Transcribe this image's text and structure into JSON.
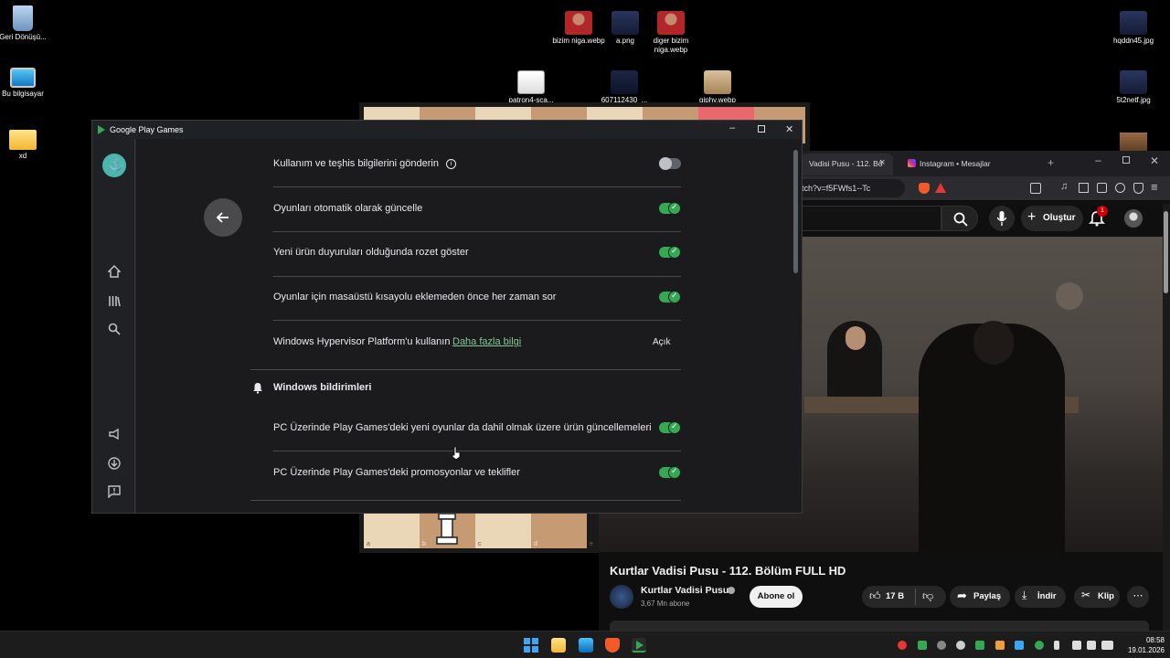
{
  "desktop": {
    "icons": [
      {
        "label": "Geri Dönüşü...",
        "name": "recycle-bin-icon"
      },
      {
        "label": "Bu bilgisayar",
        "name": "this-pc-icon"
      },
      {
        "label": "xd",
        "name": "folder-icon"
      },
      {
        "label": "bizim niga.webp",
        "name": "image-file-icon"
      },
      {
        "label": "a.png",
        "name": "image-file-icon"
      },
      {
        "label": "diger bizim niga.webp",
        "name": "image-file-icon"
      },
      {
        "label": "patron4-sca...",
        "name": "image-file-icon"
      },
      {
        "label": "607112430_...",
        "name": "image-file-icon"
      },
      {
        "label": "giphy.webp",
        "name": "image-file-icon"
      },
      {
        "label": "hqddn45.jpg",
        "name": "image-file-icon"
      },
      {
        "label": "5t2netf.jpg",
        "name": "image-file-icon"
      }
    ]
  },
  "playgames": {
    "title": "Google Play Games",
    "settings": [
      {
        "label": "Kullanım ve teşhis bilgilerini gönderin",
        "state": "off"
      },
      {
        "label": "Oyunları otomatik olarak güncelle",
        "state": "on"
      },
      {
        "label": "Yeni ürün duyuruları olduğunda rozet göster",
        "state": "on"
      },
      {
        "label": "Oyunlar için masaüstü kısayolu eklemeden önce her zaman sor",
        "state": "on"
      }
    ],
    "hypervisor": {
      "label": "Windows Hypervisor Platform'u kullanın",
      "link": "Daha fazla bilgi",
      "value": "Açık"
    },
    "notifications_section": "Windows bildirimleri",
    "notifications": [
      {
        "label": "PC Üzerinde Play Games'deki yeni oyunlar da dahil olmak üzere ürün güncellemeleri",
        "state": "on"
      },
      {
        "label": "PC Üzerinde Play Games'deki promosyonlar ve teklifler",
        "state": "on"
      }
    ]
  },
  "chess": {
    "files": [
      "a",
      "b",
      "c",
      "d",
      "e"
    ]
  },
  "browser": {
    "tabs": [
      {
        "label": "Vadisi Pusu - 112. Bö"
      },
      {
        "label": "Instagram • Mesajlar"
      }
    ],
    "tab_close": "×",
    "new_tab": "+",
    "url": "tch?v=f5FWfs1--Tc",
    "youtube": {
      "create_label": "Oluştur",
      "notification_count": "1",
      "video_title": "Kurtlar Vadisi Pusu - 112. Bölüm FULL HD",
      "channel_name": "Kurtlar Vadisi Pusu",
      "subscribers": "3,67 Mn abone",
      "subscribe_label": "Abone ol",
      "likes": "17 B",
      "share_label": "Paylaş",
      "download_label": "İndir",
      "clip_label": "Klip",
      "more_label": "⋯"
    }
  },
  "taskbar": {
    "time": "08:58",
    "date": "19.01.2026"
  },
  "colors": {
    "accent_green": "#34a853",
    "link_green": "#81c995",
    "window_bg": "#202124"
  }
}
